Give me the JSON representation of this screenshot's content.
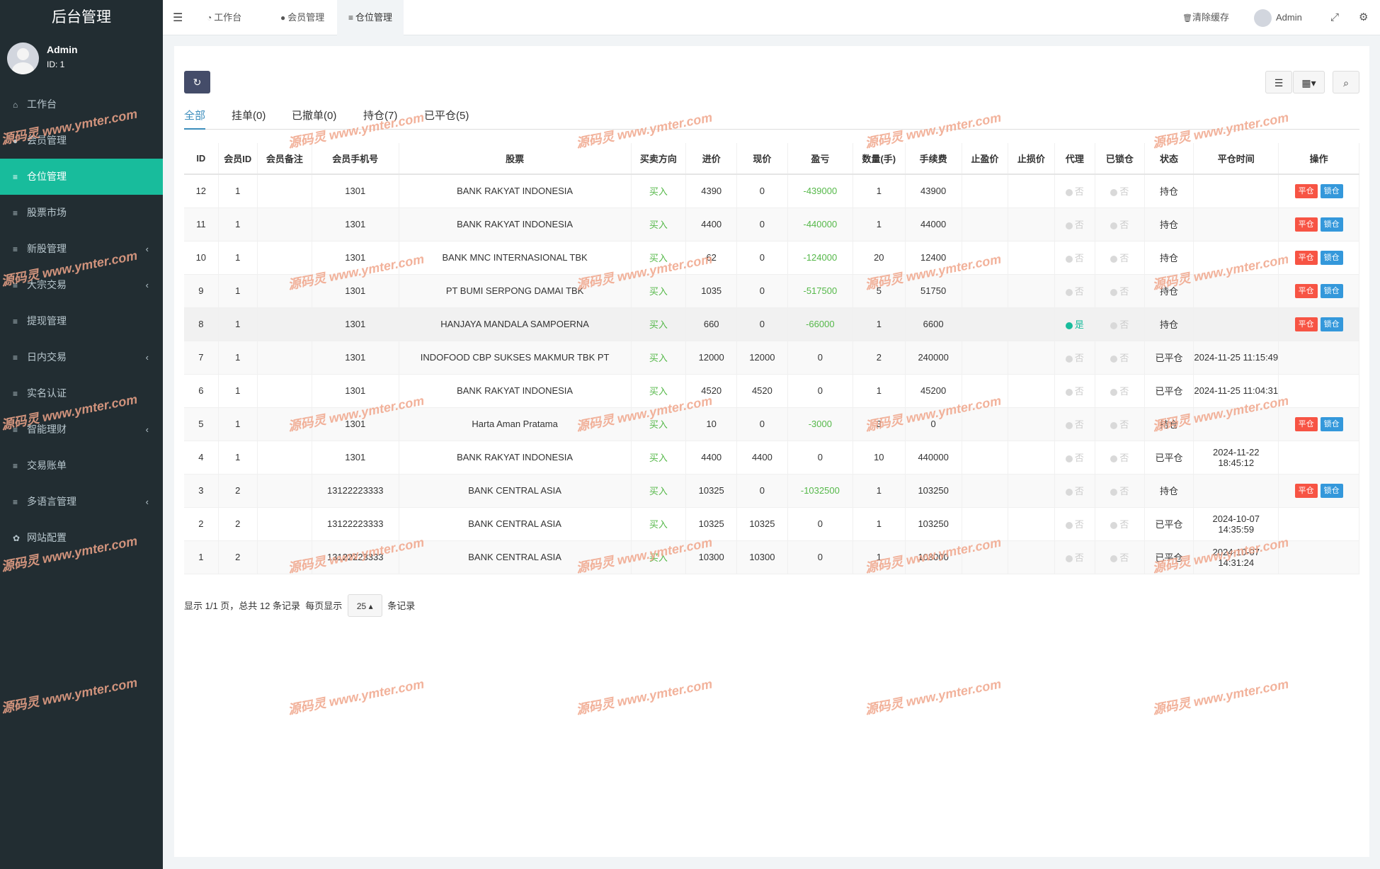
{
  "sidebar": {
    "brand": "后台管理",
    "user": {
      "name": "Admin",
      "id": "ID: 1"
    },
    "items": [
      {
        "label": "工作台",
        "icon": "dashboard-icon",
        "glyph": "⌂"
      },
      {
        "label": "会员管理",
        "icon": "user-circle-icon",
        "glyph": "●"
      },
      {
        "label": "仓位管理",
        "icon": "list-icon",
        "glyph": "≡"
      },
      {
        "label": "股票市场",
        "icon": "list-icon",
        "glyph": "≡"
      },
      {
        "label": "新股管理",
        "icon": "list-icon",
        "glyph": "≡"
      },
      {
        "label": "大宗交易",
        "icon": "list-icon",
        "glyph": "≡"
      },
      {
        "label": "提现管理",
        "icon": "list-icon",
        "glyph": "≡"
      },
      {
        "label": "日内交易",
        "icon": "list-icon",
        "glyph": "≡"
      },
      {
        "label": "实名认证",
        "icon": "list-icon",
        "glyph": "≡"
      },
      {
        "label": "智能理财",
        "icon": "list-icon",
        "glyph": "≡"
      },
      {
        "label": "交易账单",
        "icon": "list-icon",
        "glyph": "≡"
      },
      {
        "label": "多语言管理",
        "icon": "list-icon",
        "glyph": "≡"
      },
      {
        "label": "网站配置",
        "icon": "gear-icon",
        "glyph": "✿"
      }
    ]
  },
  "navbar": {
    "tabs": [
      {
        "label": "工作台",
        "icon": "dashboard-icon"
      },
      {
        "label": "会员管理",
        "icon": "user-circle-icon"
      },
      {
        "label": "仓位管理",
        "icon": "list-icon"
      }
    ],
    "clear_cache": "清除缓存",
    "admin_name": "Admin"
  },
  "filter_tabs": [
    "全部",
    "挂单(0)",
    "已撤单(0)",
    "持仓(7)",
    "已平仓(5)"
  ],
  "table": {
    "headers": [
      "ID",
      "会员ID",
      "会员备注",
      "会员手机号",
      "股票",
      "买卖方向",
      "进价",
      "现价",
      "盈亏",
      "数量(手)",
      "手续费",
      "止盈价",
      "止损价",
      "代理",
      "已锁仓",
      "状态",
      "平仓时间",
      "操作"
    ],
    "yes": "是",
    "no": "否",
    "close_btn": "平仓",
    "lock_btn": "锁仓",
    "rows": [
      {
        "id": "12",
        "uid": "1",
        "note": "",
        "phone": "1301",
        "stock": "BANK RAKYAT INDONESIA",
        "dir": "买入",
        "buy": "4390",
        "now": "0",
        "pl": "-439000",
        "qty": "1",
        "fee": "43900",
        "tp": "",
        "sl": "",
        "agent": false,
        "locked": false,
        "status": "持仓",
        "close_time": "",
        "actions": true
      },
      {
        "id": "11",
        "uid": "1",
        "note": "",
        "phone": "1301",
        "stock": "BANK RAKYAT INDONESIA",
        "dir": "买入",
        "buy": "4400",
        "now": "0",
        "pl": "-440000",
        "qty": "1",
        "fee": "44000",
        "tp": "",
        "sl": "",
        "agent": false,
        "locked": false,
        "status": "持仓",
        "close_time": "",
        "actions": true
      },
      {
        "id": "10",
        "uid": "1",
        "note": "",
        "phone": "1301",
        "stock": "BANK MNC INTERNASIONAL TBK",
        "dir": "买入",
        "buy": "62",
        "now": "0",
        "pl": "-124000",
        "qty": "20",
        "fee": "12400",
        "tp": "",
        "sl": "",
        "agent": false,
        "locked": false,
        "status": "持仓",
        "close_time": "",
        "actions": true
      },
      {
        "id": "9",
        "uid": "1",
        "note": "",
        "phone": "1301",
        "stock": "PT BUMI SERPONG DAMAI TBK",
        "dir": "买入",
        "buy": "1035",
        "now": "0",
        "pl": "-517500",
        "qty": "5",
        "fee": "51750",
        "tp": "",
        "sl": "",
        "agent": false,
        "locked": false,
        "status": "持仓",
        "close_time": "",
        "actions": true
      },
      {
        "id": "8",
        "uid": "1",
        "note": "",
        "phone": "1301",
        "stock": "HANJAYA MANDALA SAMPOERNA",
        "dir": "买入",
        "buy": "660",
        "now": "0",
        "pl": "-66000",
        "qty": "1",
        "fee": "6600",
        "tp": "",
        "sl": "",
        "agent": true,
        "locked": false,
        "status": "持仓",
        "close_time": "",
        "actions": true
      },
      {
        "id": "7",
        "uid": "1",
        "note": "",
        "phone": "1301",
        "stock": "INDOFOOD CBP SUKSES MAKMUR TBK PT",
        "dir": "买入",
        "buy": "12000",
        "now": "12000",
        "pl": "0",
        "qty": "2",
        "fee": "240000",
        "tp": "",
        "sl": "",
        "agent": false,
        "locked": false,
        "status": "已平仓",
        "close_time": "2024-11-25 11:15:49",
        "actions": false
      },
      {
        "id": "6",
        "uid": "1",
        "note": "",
        "phone": "1301",
        "stock": "BANK RAKYAT INDONESIA",
        "dir": "买入",
        "buy": "4520",
        "now": "4520",
        "pl": "0",
        "qty": "1",
        "fee": "45200",
        "tp": "",
        "sl": "",
        "agent": false,
        "locked": false,
        "status": "已平仓",
        "close_time": "2024-11-25 11:04:31",
        "actions": false
      },
      {
        "id": "5",
        "uid": "1",
        "note": "",
        "phone": "1301",
        "stock": "Harta Aman Pratama",
        "dir": "买入",
        "buy": "10",
        "now": "0",
        "pl": "-3000",
        "qty": "3",
        "fee": "0",
        "tp": "",
        "sl": "",
        "agent": false,
        "locked": false,
        "status": "持仓",
        "close_time": "",
        "actions": true
      },
      {
        "id": "4",
        "uid": "1",
        "note": "",
        "phone": "1301",
        "stock": "BANK RAKYAT INDONESIA",
        "dir": "买入",
        "buy": "4400",
        "now": "4400",
        "pl": "0",
        "qty": "10",
        "fee": "440000",
        "tp": "",
        "sl": "",
        "agent": false,
        "locked": false,
        "status": "已平仓",
        "close_time": "2024-11-22 18:45:12",
        "actions": false
      },
      {
        "id": "3",
        "uid": "2",
        "note": "",
        "phone": "13122223333",
        "stock": "BANK CENTRAL ASIA",
        "dir": "买入",
        "buy": "10325",
        "now": "0",
        "pl": "-1032500",
        "qty": "1",
        "fee": "103250",
        "tp": "",
        "sl": "",
        "agent": false,
        "locked": false,
        "status": "持仓",
        "close_time": "",
        "actions": true
      },
      {
        "id": "2",
        "uid": "2",
        "note": "",
        "phone": "13122223333",
        "stock": "BANK CENTRAL ASIA",
        "dir": "买入",
        "buy": "10325",
        "now": "10325",
        "pl": "0",
        "qty": "1",
        "fee": "103250",
        "tp": "",
        "sl": "",
        "agent": false,
        "locked": false,
        "status": "已平仓",
        "close_time": "2024-10-07 14:35:59",
        "actions": false
      },
      {
        "id": "1",
        "uid": "2",
        "note": "",
        "phone": "13122223333",
        "stock": "BANK CENTRAL ASIA",
        "dir": "买入",
        "buy": "10300",
        "now": "10300",
        "pl": "0",
        "qty": "1",
        "fee": "103000",
        "tp": "",
        "sl": "",
        "agent": false,
        "locked": false,
        "status": "已平仓",
        "close_time": "2024-10-07 14:31:24",
        "actions": false
      }
    ]
  },
  "pager": {
    "summary": "显示 1/1 页，总共 12 条记录",
    "per_page_label": "每页显示",
    "per_page_value": "25",
    "suffix": "条记录"
  },
  "watermark": "源码灵 www.ymter.com",
  "colors": {
    "sidebar_bg": "#222d32",
    "active_menu": "#18bc9c",
    "buy_green": "#55b849",
    "close_red": "#f75444",
    "lock_blue": "#3498db"
  }
}
